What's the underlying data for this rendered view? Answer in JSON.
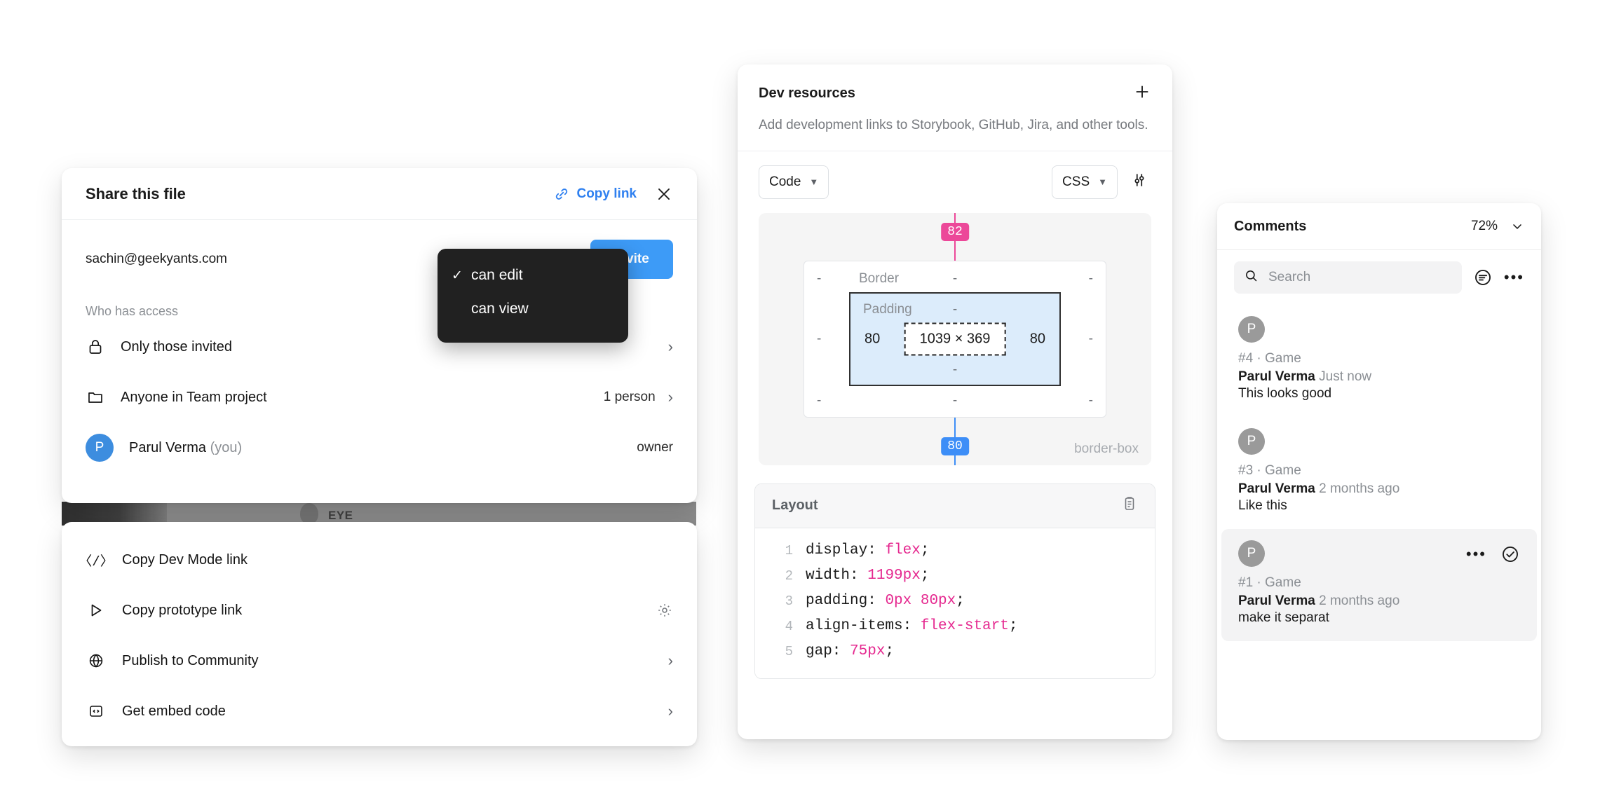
{
  "share": {
    "title": "Share this file",
    "copy_link_label": "Copy link",
    "email_value": "sachin@geekyants.com",
    "invite_label": "Invite",
    "section_label": "Who has access",
    "access_rows": [
      {
        "icon": "lock-icon",
        "label": "Only those invited",
        "right": "",
        "chevron": "›"
      },
      {
        "icon": "folder-icon",
        "label": "Anyone in Team project",
        "right": "1 person",
        "chevron": "›"
      },
      {
        "icon": "avatar",
        "label": "Parul Verma",
        "label_muted": "(you)",
        "right": "owner",
        "chevron": "",
        "avatar_initial": "P"
      }
    ],
    "permission_menu": {
      "items": [
        {
          "label": "can edit",
          "checked": true,
          "tick": "✓"
        },
        {
          "label": "can view",
          "checked": false,
          "tick": ""
        }
      ]
    }
  },
  "dev_menu": {
    "items": [
      {
        "icon": "code-slash-icon",
        "glyph": "〈/〉",
        "label": "Copy Dev Mode link",
        "trailing": ""
      },
      {
        "icon": "play-icon",
        "glyph": "",
        "label": "Copy prototype link",
        "trailing": "gear-icon"
      },
      {
        "icon": "globe-icon",
        "glyph": "",
        "label": "Publish to Community",
        "trailing": "›"
      },
      {
        "icon": "embed-code-icon",
        "glyph": "‹›",
        "label": "Get embed code",
        "trailing": "›"
      }
    ]
  },
  "dev_resources": {
    "title": "Dev resources",
    "description": "Add development links to Storybook, GitHub, Jira, and other tools.",
    "add_label": "+",
    "mode_select": "Code",
    "lang_select": "CSS",
    "box_model": {
      "top_badge": "82",
      "bottom_badge": "80",
      "border_label": "Border",
      "padding_label": "Padding",
      "content_size": "1039 × 369",
      "pad_left": "80",
      "pad_right": "80",
      "dash": "-",
      "sizing_mode": "border-box",
      "top_badge_color": "#ec4899",
      "bottom_badge_color": "#3d8ef7"
    },
    "layout_card": {
      "title": "Layout",
      "lines": [
        {
          "n": "1",
          "prop": "display:",
          "value": "flex",
          "end": ";"
        },
        {
          "n": "2",
          "prop": "width:",
          "value": "1199px",
          "end": ";"
        },
        {
          "n": "3",
          "prop": "padding:",
          "value": "0px 80px",
          "end": ";"
        },
        {
          "n": "4",
          "prop": "align-items:",
          "value": "flex-start",
          "end": ";"
        },
        {
          "n": "5",
          "prop": "gap:",
          "value": "75px",
          "end": ";"
        }
      ]
    }
  },
  "comments": {
    "title": "Comments",
    "zoom": "72%",
    "search_placeholder": "Search",
    "search_value": "",
    "items": [
      {
        "avatar": "P",
        "meta": "#4 · Game",
        "author": "Parul Verma",
        "time": "Just now",
        "body": "This looks good",
        "active": false
      },
      {
        "avatar": "P",
        "meta": "#3 · Game",
        "author": "Parul Verma",
        "time": "2 months ago",
        "body": "Like this",
        "active": false
      },
      {
        "avatar": "P",
        "meta": "#1 · Game",
        "author": "Parul Verma",
        "time": "2 months ago",
        "body": "make it separat",
        "active": true
      }
    ]
  },
  "background": {
    "partial_text": "EYE"
  }
}
